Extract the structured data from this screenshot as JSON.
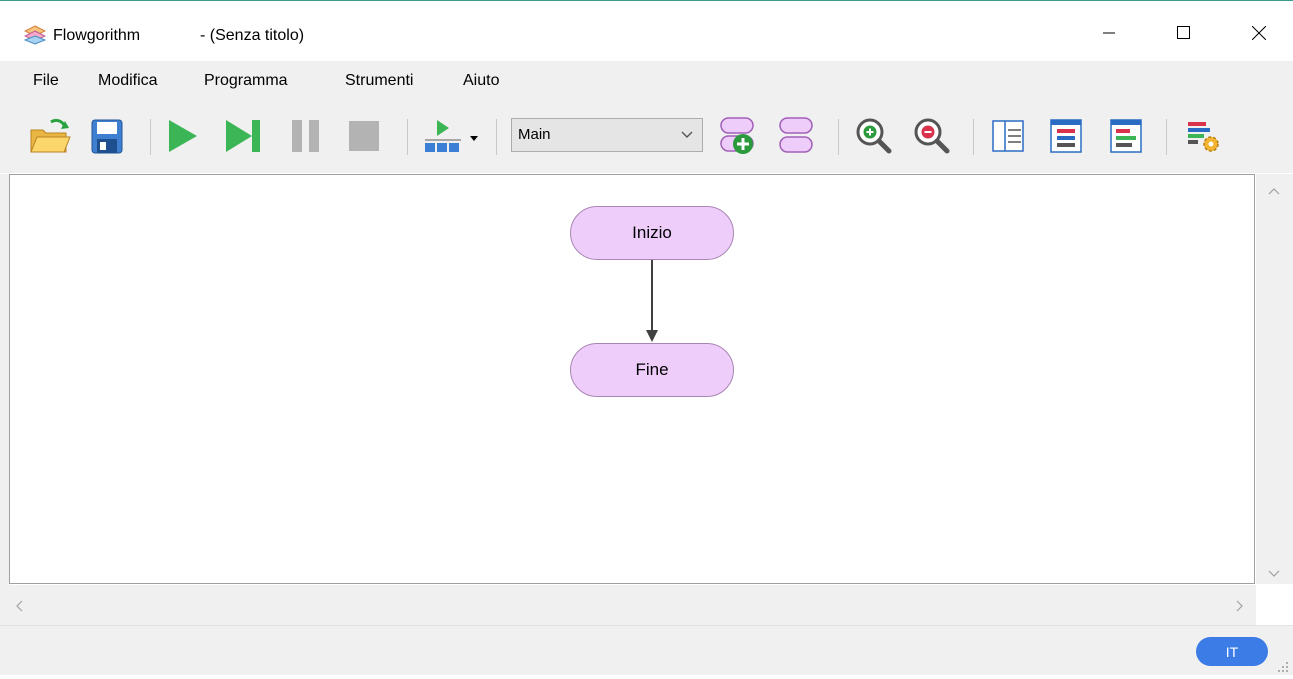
{
  "window": {
    "app_name": "Flowgorithm",
    "doc_title": "- (Senza titolo)",
    "icons": [
      "app-icon",
      "minimize-icon",
      "maximize-icon",
      "close-icon"
    ]
  },
  "menu": {
    "items": [
      "File",
      "Modifica",
      "Programma",
      "Strumenti",
      "Aiuto"
    ]
  },
  "toolbar": {
    "buttons": [
      "open-folder-icon",
      "save-icon",
      "run-icon",
      "step-icon",
      "pause-icon",
      "stop-icon",
      "run-speed-icon",
      "add-function-icon",
      "function-list-icon",
      "zoom-in-icon",
      "zoom-out-icon",
      "layout-icon",
      "variable-watch-icon",
      "console-icon",
      "settings-icon"
    ],
    "function_select": {
      "selected": "Main"
    }
  },
  "flowchart": {
    "nodes": [
      {
        "id": "start",
        "label": "Inizio"
      },
      {
        "id": "end",
        "label": "Fine"
      }
    ],
    "edges": [
      {
        "from": "start",
        "to": "end"
      }
    ],
    "node_fill": "#efcdfb",
    "node_stroke": "#a887b5"
  },
  "status": {
    "language_badge": "IT",
    "badge_color": "#3b7ce6"
  }
}
